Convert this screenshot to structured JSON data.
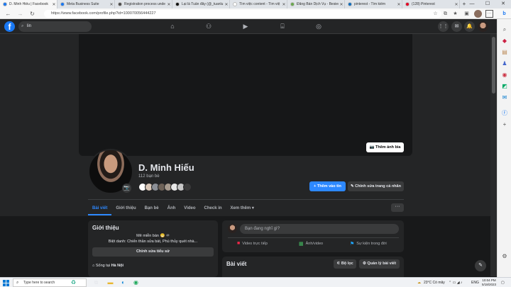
{
  "browser": {
    "tabs": [
      {
        "label": "D. Minh Hiếu | Facebook",
        "color": "#1877f2",
        "active": true
      },
      {
        "label": "Meta Business Suite",
        "color": "#1877f2",
        "active": false
      },
      {
        "label": "Registration process unde",
        "color": "#4b4b4b",
        "active": false
      },
      {
        "label": "Lại là Tuấn đây (@_tuanlu",
        "color": "#111111",
        "active": false
      },
      {
        "label": "Tìm việc content - Tìm việ",
        "color": "#ffffff",
        "active": false
      },
      {
        "label": "Đăng Bán Dịch Vụ - Besiec",
        "color": "#6aa84f",
        "active": false
      },
      {
        "label": "pinterest - Tìm kiếm",
        "color": "#0f6cbd",
        "active": false
      },
      {
        "label": "(128) Pinterest",
        "color": "#e60023",
        "active": false
      }
    ],
    "url": "https://www.facebook.com/profile.php?id=100070056444227"
  },
  "fb_nav": {
    "search_value": "lin"
  },
  "profile": {
    "name": "D. Minh Hiếu",
    "friends": "112 bạn bè",
    "add_cover_label": "Thêm ảnh bìa",
    "add_story_label": "+ Thêm vào tin",
    "edit_profile_label": "✎ Chỉnh sửa trang cá nhân",
    "more_label": "···",
    "friend_face_colors": [
      "#ffffff",
      "#d9c7b8",
      "#8b8f96",
      "#6e6258",
      "#a89b8f",
      "#e8e8e8",
      "#c7c7c7",
      "#3a3a3a"
    ]
  },
  "profile_tabs": [
    "Bài viết",
    "Giới thiệu",
    "Bạn bè",
    "Ảnh",
    "Video",
    "Check in",
    "Xem thêm ▾"
  ],
  "intro": {
    "title": "Giới thiệu",
    "bio_line1": "Mê miễn bàn 😁 ♾",
    "bio_line2": "Biệt danh: Chiến thần sửa bát, Phù thủy quét nhà...",
    "edit_bio_label": "Chỉnh sửa tiểu sử",
    "lives_prefix": "Sống tại ",
    "lives_city": "Hà Nội"
  },
  "composer": {
    "placeholder": "Bạn đang nghĩ gì?",
    "live_label": "Video trực tiếp",
    "photo_label": "Ảnh/video",
    "event_label": "Sự kiện trong đời"
  },
  "posts": {
    "title": "Bài viết",
    "filter_label": "⚟ Bộ lọc",
    "manage_label": "⚙ Quản lý bài viết"
  },
  "taskbar": {
    "search_placeholder": "Type here to search",
    "weather": "23°C  Có mây",
    "lang": "ENG",
    "time": "10:04 PM",
    "date": "5/18/2023"
  }
}
